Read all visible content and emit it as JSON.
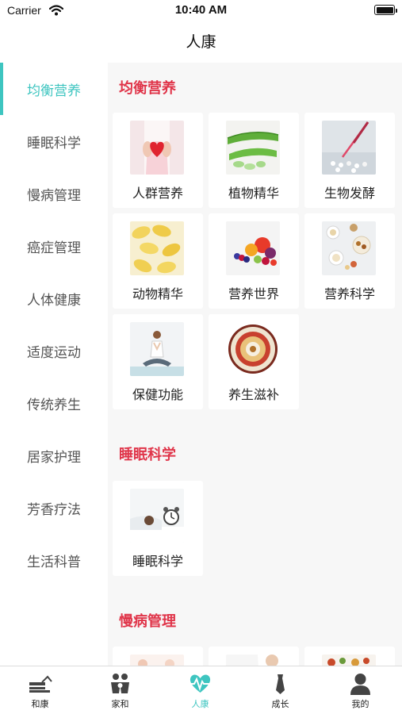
{
  "status_bar": {
    "carrier": "Carrier",
    "time": "10:40 AM"
  },
  "nav": {
    "title": "人康"
  },
  "colors": {
    "accent": "#3ec5c0",
    "section_title": "#e0354a"
  },
  "sidebar": {
    "active_index": 0,
    "items": [
      {
        "label": "均衡营养"
      },
      {
        "label": "睡眠科学"
      },
      {
        "label": "慢病管理"
      },
      {
        "label": "癌症管理"
      },
      {
        "label": "人体健康"
      },
      {
        "label": "适度运动"
      },
      {
        "label": "传统养生"
      },
      {
        "label": "居家护理"
      },
      {
        "label": "芳香疗法"
      },
      {
        "label": "生活科普"
      }
    ]
  },
  "sections": [
    {
      "title": "均衡营养",
      "items": [
        {
          "label": "人群营养",
          "icon": "heart-hands-photo"
        },
        {
          "label": "植物精华",
          "icon": "aloe-photo"
        },
        {
          "label": "生物发酵",
          "icon": "lab-pipette-photo"
        },
        {
          "label": "动物精华",
          "icon": "softgel-capsules-photo"
        },
        {
          "label": "营养世界",
          "icon": "fruits-photo"
        },
        {
          "label": "营养科学",
          "icon": "nuts-bowls-photo"
        },
        {
          "label": "保健功能",
          "icon": "yoga-photo"
        },
        {
          "label": "养生滋补",
          "icon": "herbal-platter-photo"
        }
      ]
    },
    {
      "title": "睡眠科学",
      "items": [
        {
          "label": "睡眠科学",
          "icon": "sleep-alarm-photo"
        }
      ]
    },
    {
      "title": "慢病管理",
      "items": []
    }
  ],
  "tabs": [
    {
      "label": "和康",
      "icon": "house-icon"
    },
    {
      "label": "家和",
      "icon": "family-icon"
    },
    {
      "label": "人康",
      "icon": "heart-pulse-icon"
    },
    {
      "label": "成长",
      "icon": "tie-icon"
    },
    {
      "label": "我的",
      "icon": "person-icon"
    }
  ]
}
